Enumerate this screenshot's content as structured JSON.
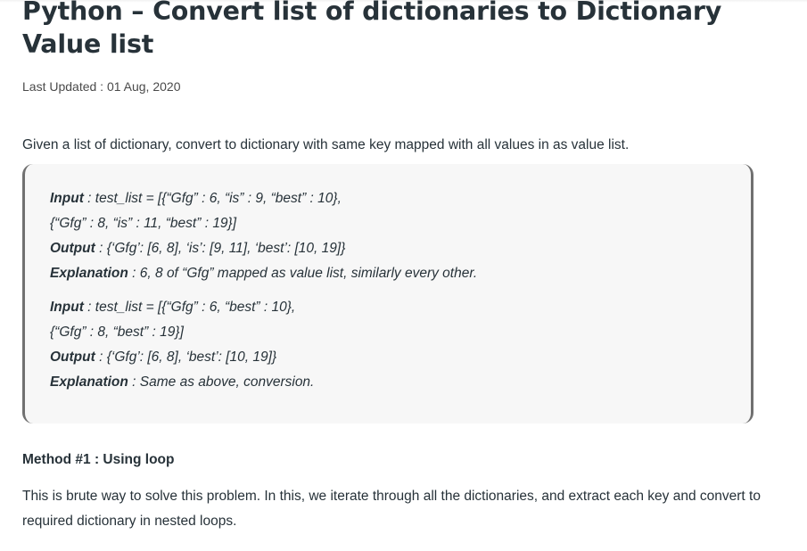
{
  "article": {
    "title": "Python – Convert list of dictionaries to Dictionary Value list",
    "last_updated": "Last Updated : 01 Aug, 2020",
    "intro": "Given a list of dictionary, convert to dictionary with same key mapped with all values in as value list."
  },
  "examples": [
    {
      "input_label": "Input",
      "input_line1": " : test_list = [{“Gfg” : 6, “is” : 9, “best” : 10},",
      "input_line2": "{“Gfg” : 8, “is” : 11, “best” : 19}]",
      "output_label": "Output",
      "output_text": " : {‘Gfg’: [6, 8], ‘is’: [9, 11], ‘best’: [10, 19]}",
      "explanation_label": "Explanation",
      "explanation_text": " : 6, 8 of “Gfg” mapped as value list, similarly every other."
    },
    {
      "input_label": "Input",
      "input_line1": " : test_list = [{“Gfg” : 6, “best” : 10},",
      "input_line2": "{“Gfg” : 8, “best” : 19}]",
      "output_label": "Output",
      "output_text": " : {‘Gfg’: [6, 8], ‘best’: [10, 19]}",
      "explanation_label": "Explanation",
      "explanation_text": " : Same as above, conversion."
    }
  ],
  "method": {
    "heading": "Method #1 : Using loop",
    "description": "This is brute way to solve this problem. In this, we iterate through all the dictionaries, and extract each key and convert to required dictionary in nested loops."
  }
}
